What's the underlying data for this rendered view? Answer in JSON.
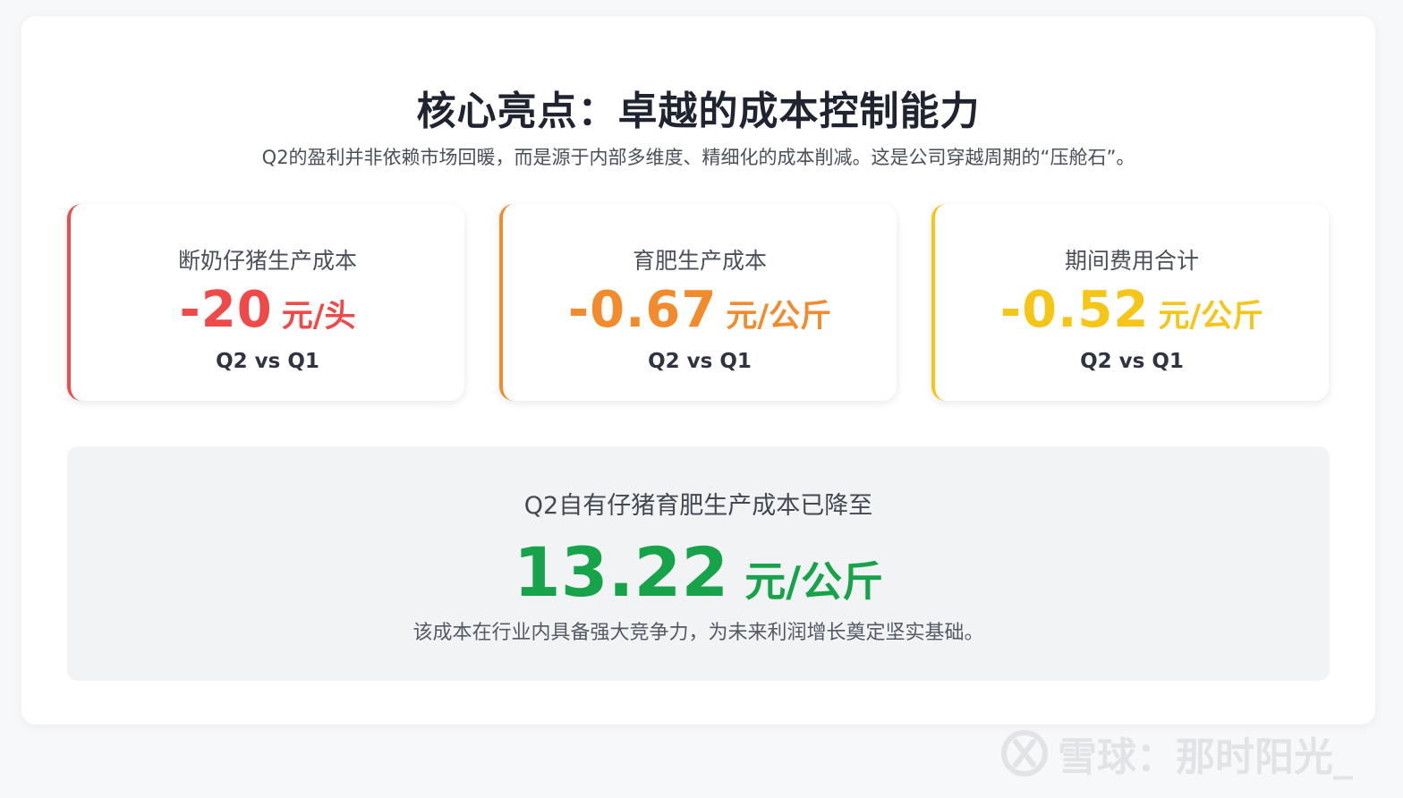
{
  "page": {
    "title": "核心亮点：卓越的成本控制能力",
    "subtitle": "Q2的盈利并非依赖市场回暖，而是源于内部多维度、精细化的成本削减。这是公司穿越周期的“压舱石”。"
  },
  "metrics": [
    {
      "label": "断奶仔猪生产成本",
      "value": "-20",
      "unit": "元/头",
      "compare": "Q2 vs Q1",
      "color": "#ef4a4a"
    },
    {
      "label": "育肥生产成本",
      "value": "-0.67",
      "unit": "元/公斤",
      "compare": "Q2 vs Q1",
      "color": "#f28a2e"
    },
    {
      "label": "期间费用合计",
      "value": "-0.52",
      "unit": "元/公斤",
      "compare": "Q2 vs Q1",
      "color": "#f5c518"
    }
  ],
  "summary": {
    "label": "Q2自有仔猪育肥生产成本已降至",
    "value": "13.22",
    "unit": "元/公斤",
    "note": "该成本在行业内具备强大竞争力，为未来利润增长奠定坚实基础。",
    "color": "#16a34a"
  },
  "watermark": {
    "text": "雪球：那时阳光_",
    "icon": "xueqiu-logo-icon"
  }
}
